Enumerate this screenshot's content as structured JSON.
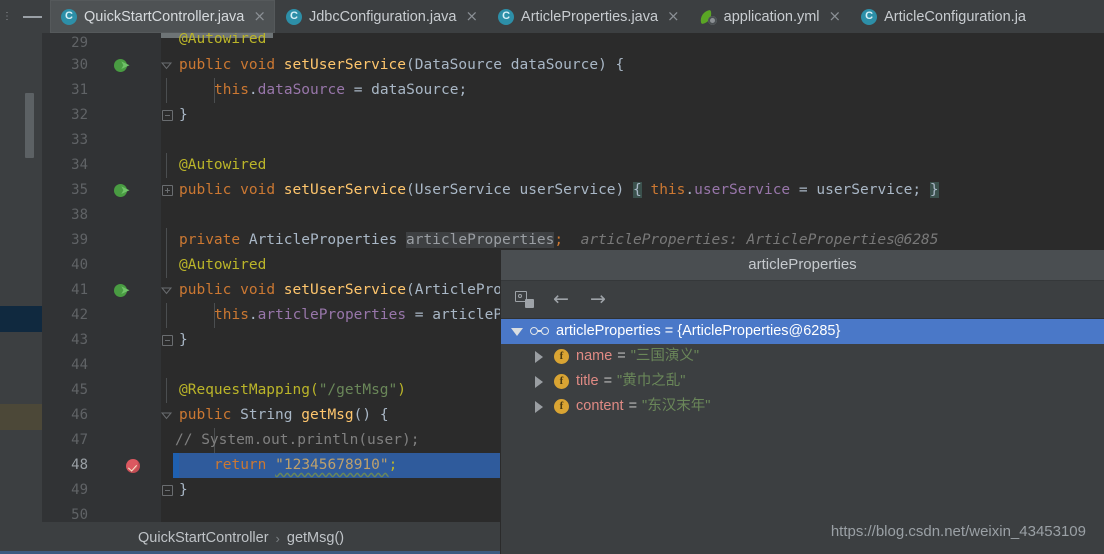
{
  "window": {
    "edge_hint": "⋮",
    "minimize_label": "minimize"
  },
  "tabs": [
    {
      "label": "QuickStartController.java",
      "icon": "java-class-icon",
      "active": true,
      "close": "×"
    },
    {
      "label": "JdbcConfiguration.java",
      "icon": "java-class-icon",
      "active": false,
      "close": "×"
    },
    {
      "label": "ArticleProperties.java",
      "icon": "java-class-icon",
      "active": false,
      "close": "×"
    },
    {
      "label": "application.yml",
      "icon": "spring-yaml-icon",
      "active": false,
      "close": "×"
    },
    {
      "label": "ArticleConfiguration.ja",
      "icon": "java-class-icon",
      "active": false,
      "close": ""
    }
  ],
  "editor": {
    "lines": [
      {
        "num": "29",
        "text": "    @Autowired"
      },
      {
        "num": "30",
        "text": "    public void setUserService(DataSource dataSource) {"
      },
      {
        "num": "31",
        "text": "        this.dataSource = dataSource;"
      },
      {
        "num": "32",
        "text": "    }"
      },
      {
        "num": "33",
        "text": ""
      },
      {
        "num": "34",
        "text": "    @Autowired"
      },
      {
        "num": "35",
        "text": "    public void setUserService(UserService userService) { this.userService = userService; }"
      },
      {
        "num": "38",
        "text": ""
      },
      {
        "num": "39",
        "text": "    private ArticleProperties articleProperties;"
      },
      {
        "num": "40",
        "text": "    @Autowired"
      },
      {
        "num": "41",
        "text": "    public void setUserService(ArticleProperties articleProperties) {"
      },
      {
        "num": "42",
        "text": "        this.articleProperties = articleProperties;"
      },
      {
        "num": "43",
        "text": "    }"
      },
      {
        "num": "44",
        "text": ""
      },
      {
        "num": "45",
        "text": "    @RequestMapping(\"/getMsg\")"
      },
      {
        "num": "46",
        "text": "    public String getMsg() {"
      },
      {
        "num": "47",
        "text": "//        System.out.println(user);"
      },
      {
        "num": "48",
        "text": "        return \"12345678910\";"
      },
      {
        "num": "49",
        "text": "    }"
      },
      {
        "num": "50",
        "text": ""
      }
    ],
    "inline_hint_39": "articleProperties: ArticleProperties@6285",
    "highlighted_line": "48",
    "breakpoint_line": "48"
  },
  "code": {
    "kw_public": "public",
    "kw_void": "void",
    "kw_private": "private",
    "kw_return": "return",
    "kw_this": "this",
    "ann_autowired": "@Autowired",
    "ann_requestmapping": "@RequestMapping",
    "m_setUserService": "setUserService",
    "m_getMsg": "getMsg",
    "t_DataSource": "DataSource",
    "t_UserService": "UserService",
    "t_ArticleProperties": "ArticleProperties",
    "t_String": "String",
    "v_dataSource": "dataSource",
    "v_userService": "userService",
    "v_articleProperties": "articleProperties",
    "s_getMsg_path": "\"/getMsg\"",
    "s_return_value": "\"12345678910\"",
    "comment_println": "//        System.out.println(user);",
    "hint_39": "articleProperties: ArticleProperties@6285"
  },
  "breadcrumb": {
    "items": [
      "QuickStartController",
      "getMsg()"
    ],
    "separator": "›"
  },
  "popup": {
    "title": "articleProperties",
    "toolbar": [
      {
        "name": "new-watch-icon",
        "glyph": ""
      },
      {
        "name": "back-arrow-icon",
        "glyph": "←"
      },
      {
        "name": "forward-arrow-icon",
        "glyph": "→"
      }
    ],
    "root": {
      "label": "articleProperties = {ArticleProperties@6285}",
      "expanded": true,
      "selected": true,
      "icon": "watch-glasses-icon"
    },
    "fields": [
      {
        "icon": "field-icon",
        "name": "name",
        "eq": "=",
        "value": "\"三国演义\""
      },
      {
        "icon": "field-icon",
        "name": "title",
        "eq": "=",
        "value": "\"黄巾之乱\""
      },
      {
        "icon": "field-icon",
        "name": "content",
        "eq": "=",
        "value": "\"东汉末年\""
      }
    ]
  },
  "watermark": "https://blog.csdn.net/weixin_43453109",
  "colors": {
    "accent_blue": "#4a78c8",
    "selection_line": "#2f5b9c",
    "string_green": "#6a8759",
    "keyword_orange": "#cc7832",
    "annotation_yellow": "#bbb529",
    "field_red": "#e08a84",
    "breakpoint_red": "#db5860",
    "bg_editor": "#2b2b2b",
    "bg_chrome": "#3c3f41"
  }
}
